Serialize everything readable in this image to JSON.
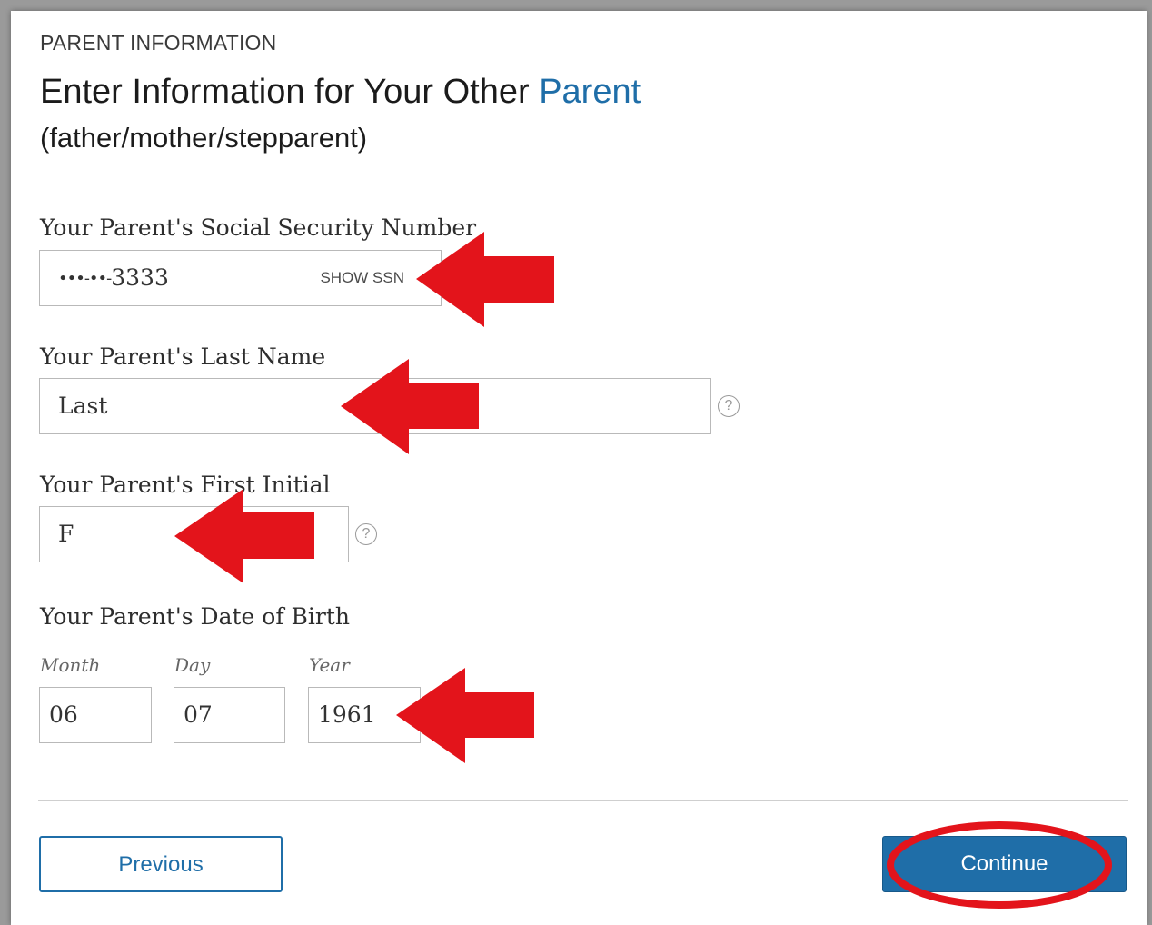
{
  "header": {
    "eyebrow": "PARENT INFORMATION",
    "title_main": "Enter Information for Your Other ",
    "title_accent": "Parent",
    "subtitle": "(father/mother/stepparent)"
  },
  "ssn": {
    "label": "Your Parent's Social Security Number",
    "mask": "•••-••-",
    "last4": "3333",
    "toggle_label": "SHOW SSN"
  },
  "last_name": {
    "label": "Your Parent's Last Name",
    "value": "Last"
  },
  "first_initial": {
    "label": "Your Parent's First Initial",
    "value": "F"
  },
  "dob": {
    "label": "Your Parent's Date of Birth",
    "month_label": "Month",
    "day_label": "Day",
    "year_label": "Year",
    "month": "06",
    "day": "07",
    "year": "1961"
  },
  "help_glyph": "?",
  "buttons": {
    "previous": "Previous",
    "continue": "Continue"
  },
  "colors": {
    "accent": "#1f6ea8",
    "annotation": "#e3141b"
  },
  "icons": [
    "help-icon",
    "arrow-annotation",
    "circle-annotation"
  ]
}
